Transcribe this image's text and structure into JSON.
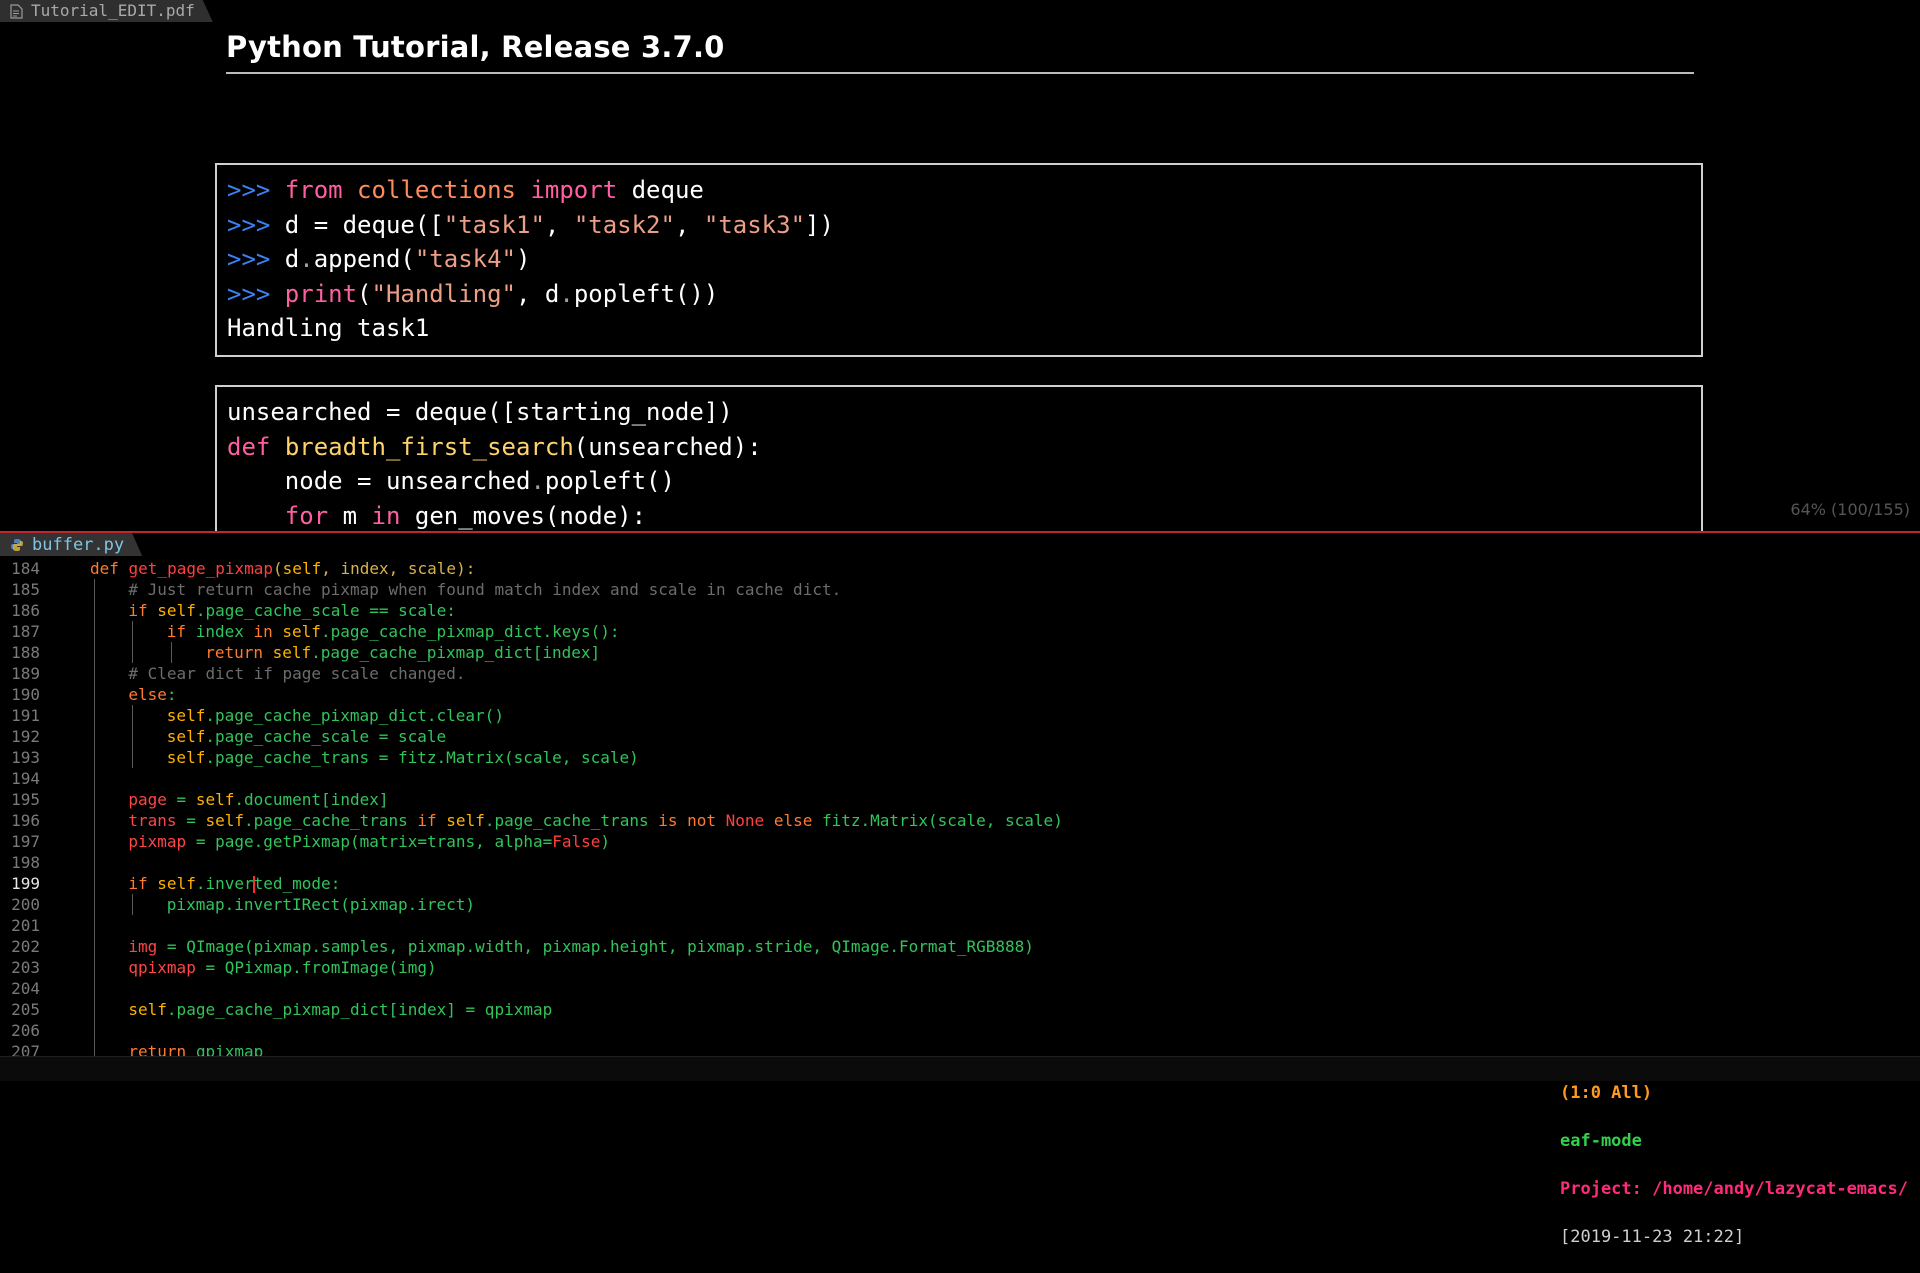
{
  "pdf": {
    "tab_label": "Tutorial_EDIT.pdf",
    "title": "Python Tutorial, Release 3.7.0",
    "page_info": "64% (100/155)",
    "box1_lines": [
      [
        {
          "t": ">>> ",
          "c": "p"
        },
        {
          "t": "from",
          "c": "k"
        },
        {
          "t": " "
        },
        {
          "t": "collections",
          "c": "m"
        },
        {
          "t": " "
        },
        {
          "t": "import",
          "c": "k"
        },
        {
          "t": " deque"
        }
      ],
      [
        {
          "t": ">>> ",
          "c": "p"
        },
        {
          "t": "d = deque(["
        },
        {
          "t": "\"task1\"",
          "c": "s"
        },
        {
          "t": ", "
        },
        {
          "t": "\"task2\"",
          "c": "s"
        },
        {
          "t": ", "
        },
        {
          "t": "\"task3\"",
          "c": "s"
        },
        {
          "t": "])"
        }
      ],
      [
        {
          "t": ">>> ",
          "c": "p"
        },
        {
          "t": "d"
        },
        {
          "t": ".",
          "c": "dot"
        },
        {
          "t": "append("
        },
        {
          "t": "\"task4\"",
          "c": "s"
        },
        {
          "t": ")"
        }
      ],
      [
        {
          "t": ">>> ",
          "c": "p"
        },
        {
          "t": "print",
          "c": "k"
        },
        {
          "t": "("
        },
        {
          "t": "\"Handling\"",
          "c": "s"
        },
        {
          "t": ", d"
        },
        {
          "t": ".",
          "c": "dot"
        },
        {
          "t": "popleft())"
        }
      ],
      [
        {
          "t": "Handling task1"
        }
      ]
    ],
    "box2_lines": [
      [
        {
          "t": "unsearched = deque([starting_node])"
        }
      ],
      [
        {
          "t": "def",
          "c": "k"
        },
        {
          "t": " "
        },
        {
          "t": "breadth_first_search",
          "c": "f"
        },
        {
          "t": "(unsearched):"
        }
      ],
      [
        {
          "t": "    node = unsearched"
        },
        {
          "t": ".",
          "c": "dot"
        },
        {
          "t": "popleft()"
        }
      ],
      [
        {
          "t": "    "
        },
        {
          "t": "for",
          "c": "k"
        },
        {
          "t": " m "
        },
        {
          "t": "in",
          "c": "k"
        },
        {
          "t": " gen_moves(node):"
        }
      ]
    ]
  },
  "editor": {
    "tab_label": "buffer.py",
    "current_line": "199",
    "lines": [
      {
        "n": "184",
        "indent": 0,
        "tokens": [
          {
            "t": "def ",
            "c": "kw"
          },
          {
            "t": "get_page_pixmap",
            "c": "fn"
          },
          {
            "t": "(",
            "c": "par"
          },
          {
            "t": "self",
            "c": "self"
          },
          {
            "t": ", index, scale):",
            "c": "par"
          }
        ]
      },
      {
        "n": "185",
        "indent": 1,
        "tokens": [
          {
            "t": "# Just return cache pixmap when found match index and scale in cache dict.",
            "c": "cm"
          }
        ]
      },
      {
        "n": "186",
        "indent": 1,
        "tokens": [
          {
            "t": "if ",
            "c": "kw"
          },
          {
            "t": "self",
            "c": "self"
          },
          {
            "t": ".page_cache_scale == scale:",
            "c": "attr"
          }
        ]
      },
      {
        "n": "187",
        "indent": 2,
        "tokens": [
          {
            "t": "if ",
            "c": "kw"
          },
          {
            "t": "index ",
            "c": "attr"
          },
          {
            "t": "in ",
            "c": "kw"
          },
          {
            "t": "self",
            "c": "self"
          },
          {
            "t": ".page_cache_pixmap_dict.keys():",
            "c": "attr"
          }
        ]
      },
      {
        "n": "188",
        "indent": 3,
        "tokens": [
          {
            "t": "return ",
            "c": "kw"
          },
          {
            "t": "self",
            "c": "self"
          },
          {
            "t": ".page_cache_pixmap_dict[index]",
            "c": "attr"
          }
        ]
      },
      {
        "n": "189",
        "indent": 1,
        "tokens": [
          {
            "t": "# Clear dict if page scale changed.",
            "c": "cm"
          }
        ]
      },
      {
        "n": "190",
        "indent": 1,
        "tokens": [
          {
            "t": "else",
            "c": "kw"
          },
          {
            "t": ":",
            "c": "attr"
          }
        ]
      },
      {
        "n": "191",
        "indent": 2,
        "tokens": [
          {
            "t": "self",
            "c": "self"
          },
          {
            "t": ".page_cache_pixmap_dict.clear()",
            "c": "attr"
          }
        ]
      },
      {
        "n": "192",
        "indent": 2,
        "tokens": [
          {
            "t": "self",
            "c": "self"
          },
          {
            "t": ".page_cache_scale = scale",
            "c": "attr"
          }
        ]
      },
      {
        "n": "193",
        "indent": 2,
        "tokens": [
          {
            "t": "self",
            "c": "self"
          },
          {
            "t": ".page_cache_trans = fitz.Matrix(scale, scale)",
            "c": "attr"
          }
        ]
      },
      {
        "n": "194",
        "indent": 1,
        "tokens": []
      },
      {
        "n": "195",
        "indent": 1,
        "tokens": [
          {
            "t": "page",
            "c": "var"
          },
          {
            "t": " = ",
            "c": "attr"
          },
          {
            "t": "self",
            "c": "self"
          },
          {
            "t": ".document[index]",
            "c": "attr"
          }
        ]
      },
      {
        "n": "196",
        "indent": 1,
        "tokens": [
          {
            "t": "trans",
            "c": "var"
          },
          {
            "t": " = ",
            "c": "attr"
          },
          {
            "t": "self",
            "c": "self"
          },
          {
            "t": ".page_cache_trans ",
            "c": "attr"
          },
          {
            "t": "if ",
            "c": "kw"
          },
          {
            "t": "self",
            "c": "self"
          },
          {
            "t": ".page_cache_trans ",
            "c": "attr"
          },
          {
            "t": "is not ",
            "c": "kw"
          },
          {
            "t": "None ",
            "c": "bool"
          },
          {
            "t": "else ",
            "c": "kw"
          },
          {
            "t": "fitz.Matrix(scale, scale)",
            "c": "attr"
          }
        ]
      },
      {
        "n": "197",
        "indent": 1,
        "tokens": [
          {
            "t": "pixmap",
            "c": "var"
          },
          {
            "t": " = page.getPixmap(matrix=trans, alpha=",
            "c": "attr"
          },
          {
            "t": "False",
            "c": "bool"
          },
          {
            "t": ")",
            "c": "attr"
          }
        ]
      },
      {
        "n": "198",
        "indent": 1,
        "tokens": []
      },
      {
        "n": "199",
        "indent": 1,
        "cursor_after": "self.inver",
        "tokens": [
          {
            "t": "if ",
            "c": "kw"
          },
          {
            "t": "self",
            "c": "self"
          },
          {
            "t": ".inver",
            "c": "attr"
          },
          {
            "t": "",
            "c": "cursor"
          },
          {
            "t": "ted_mode:",
            "c": "attr"
          }
        ]
      },
      {
        "n": "200",
        "indent": 2,
        "tokens": [
          {
            "t": "pixmap.invertIRect(pixmap.irect)",
            "c": "attr"
          }
        ]
      },
      {
        "n": "201",
        "indent": 1,
        "tokens": []
      },
      {
        "n": "202",
        "indent": 1,
        "tokens": [
          {
            "t": "img",
            "c": "var"
          },
          {
            "t": " = QImage(pixmap.samples, pixmap.width, pixmap.height, pixmap.stride, QImage.Format_RGB888)",
            "c": "attr"
          }
        ]
      },
      {
        "n": "203",
        "indent": 1,
        "tokens": [
          {
            "t": "qpixmap",
            "c": "var"
          },
          {
            "t": " = QPixmap.fromImage(img)",
            "c": "attr"
          }
        ]
      },
      {
        "n": "204",
        "indent": 1,
        "tokens": []
      },
      {
        "n": "205",
        "indent": 1,
        "tokens": [
          {
            "t": "self",
            "c": "self"
          },
          {
            "t": ".page_cache_pixmap_dict[index] = qpixmap",
            "c": "attr"
          }
        ]
      },
      {
        "n": "206",
        "indent": 1,
        "tokens": []
      },
      {
        "n": "207",
        "indent": 1,
        "tokens": [
          {
            "t": "return ",
            "c": "kw"
          },
          {
            "t": "qpixmap",
            "c": "attr"
          }
        ]
      }
    ]
  },
  "modeline": {
    "position": "(1:0 All)",
    "mode": "eaf-mode",
    "project": "Project: /home/andy/lazycat-emacs/",
    "datetime": "[2019-11-23 21:22]"
  },
  "colors": {
    "split_line": "#c0262d",
    "prompt": "#3b82f6",
    "keyword": "#ff5fa2",
    "string": "#ec9f86"
  },
  "icons": {
    "pdf_tab": "document-icon",
    "py_tab": "python-icon"
  }
}
